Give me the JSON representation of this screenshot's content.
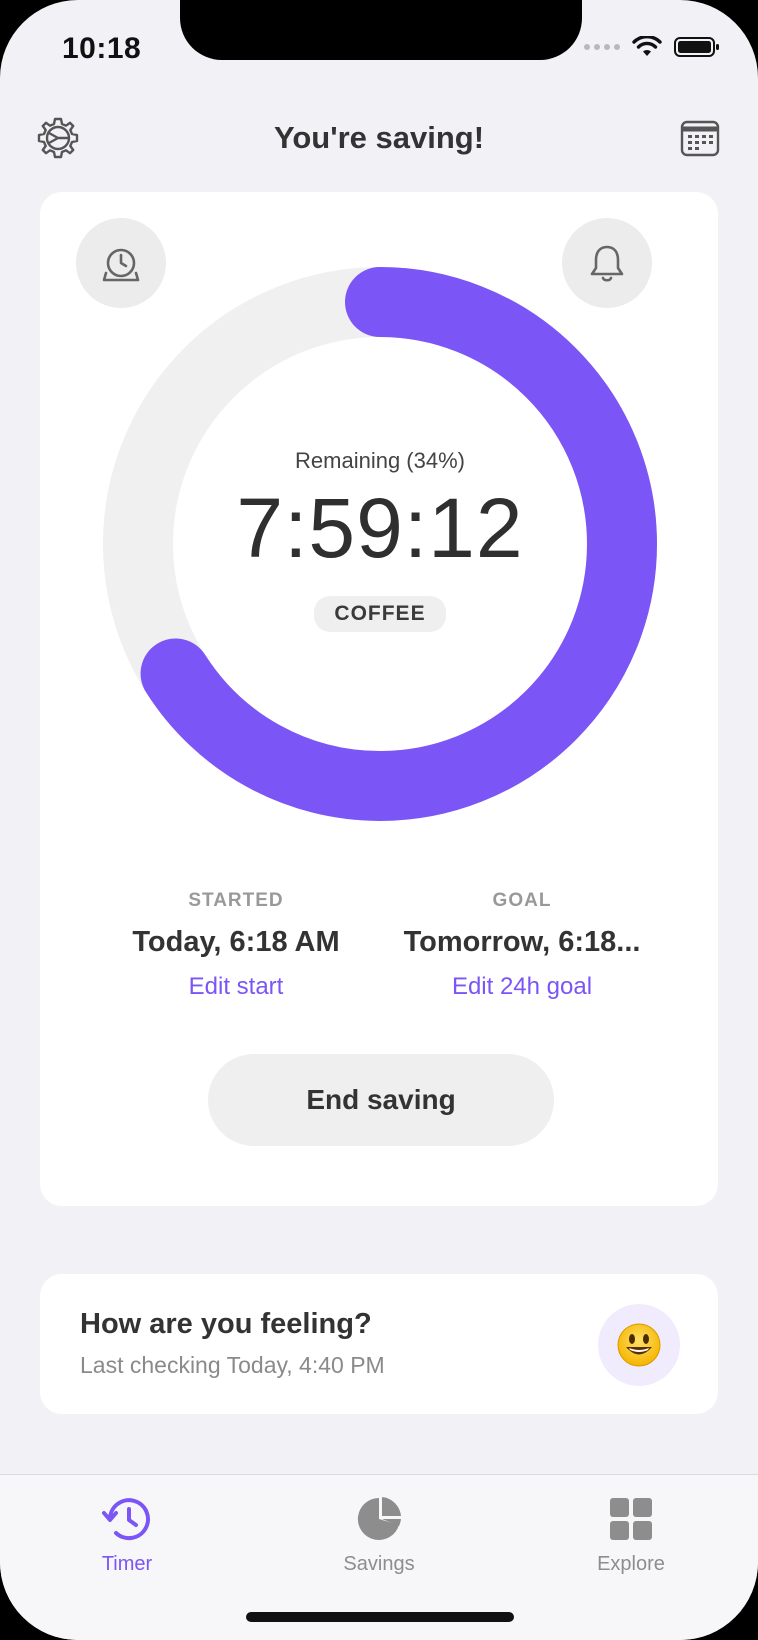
{
  "status_bar": {
    "time": "10:18"
  },
  "header": {
    "title": "You're saving!"
  },
  "timer": {
    "remaining_label": "Remaining (34%)",
    "remaining_fraction": 0.34,
    "elapsed_fraction": 0.66,
    "time_value": "7:59:12",
    "category": "COFFEE"
  },
  "started": {
    "label": "STARTED",
    "value": "Today, 6:18 AM",
    "link": "Edit start"
  },
  "goal": {
    "label": "GOAL",
    "value": "Tomorrow, 6:18...",
    "link": "Edit 24h goal"
  },
  "end_button": {
    "label": "End saving"
  },
  "feeling": {
    "title": "How are you feeling?",
    "subtitle": "Last checking Today, 4:40 PM",
    "emoji_icon": "smiley-face-icon"
  },
  "tabs": [
    {
      "label": "Timer",
      "icon": "timer-history-icon",
      "active": true
    },
    {
      "label": "Savings",
      "icon": "pie-chart-icon",
      "active": false
    },
    {
      "label": "Explore",
      "icon": "grid-icon",
      "active": false
    }
  ],
  "colors": {
    "accent": "#7b55f5",
    "background": "#f2f1f6",
    "card": "#ffffff",
    "track": "#f0f0f0"
  }
}
